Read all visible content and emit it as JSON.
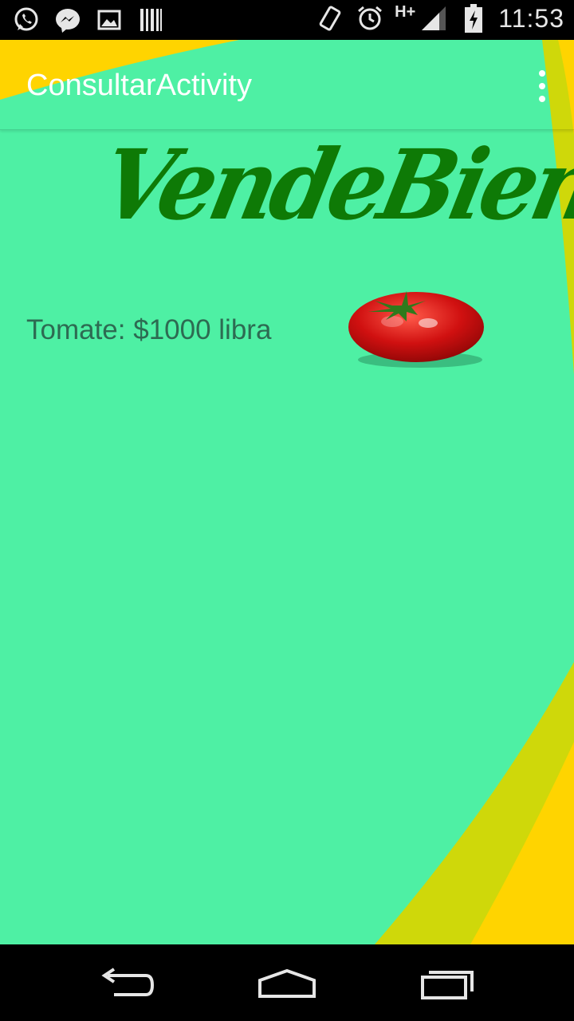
{
  "status_bar": {
    "time": "11:53",
    "network": "H+",
    "left_icons": [
      "whatsapp-icon",
      "messenger-icon",
      "gallery-icon",
      "barcode-icon"
    ],
    "right_icons": [
      "vibrate-icon",
      "alarm-icon",
      "signal-icon",
      "battery-charging-icon"
    ]
  },
  "action_bar": {
    "title": "ConsultarActivity",
    "overflow_icon": "more-vertical-icon"
  },
  "logo": {
    "text": "VendeBien",
    "color": "#0e7a06"
  },
  "product": {
    "label": "Tomate: $1000 libra",
    "image": "tomato-image"
  },
  "nav_bar": {
    "icons": [
      "back-icon",
      "home-icon",
      "recents-icon"
    ]
  },
  "colors": {
    "background": "#4ef0a4",
    "accent_yellow": "#ffd400",
    "accent_olive": "#cfd80a",
    "text": "#2d6b52"
  }
}
